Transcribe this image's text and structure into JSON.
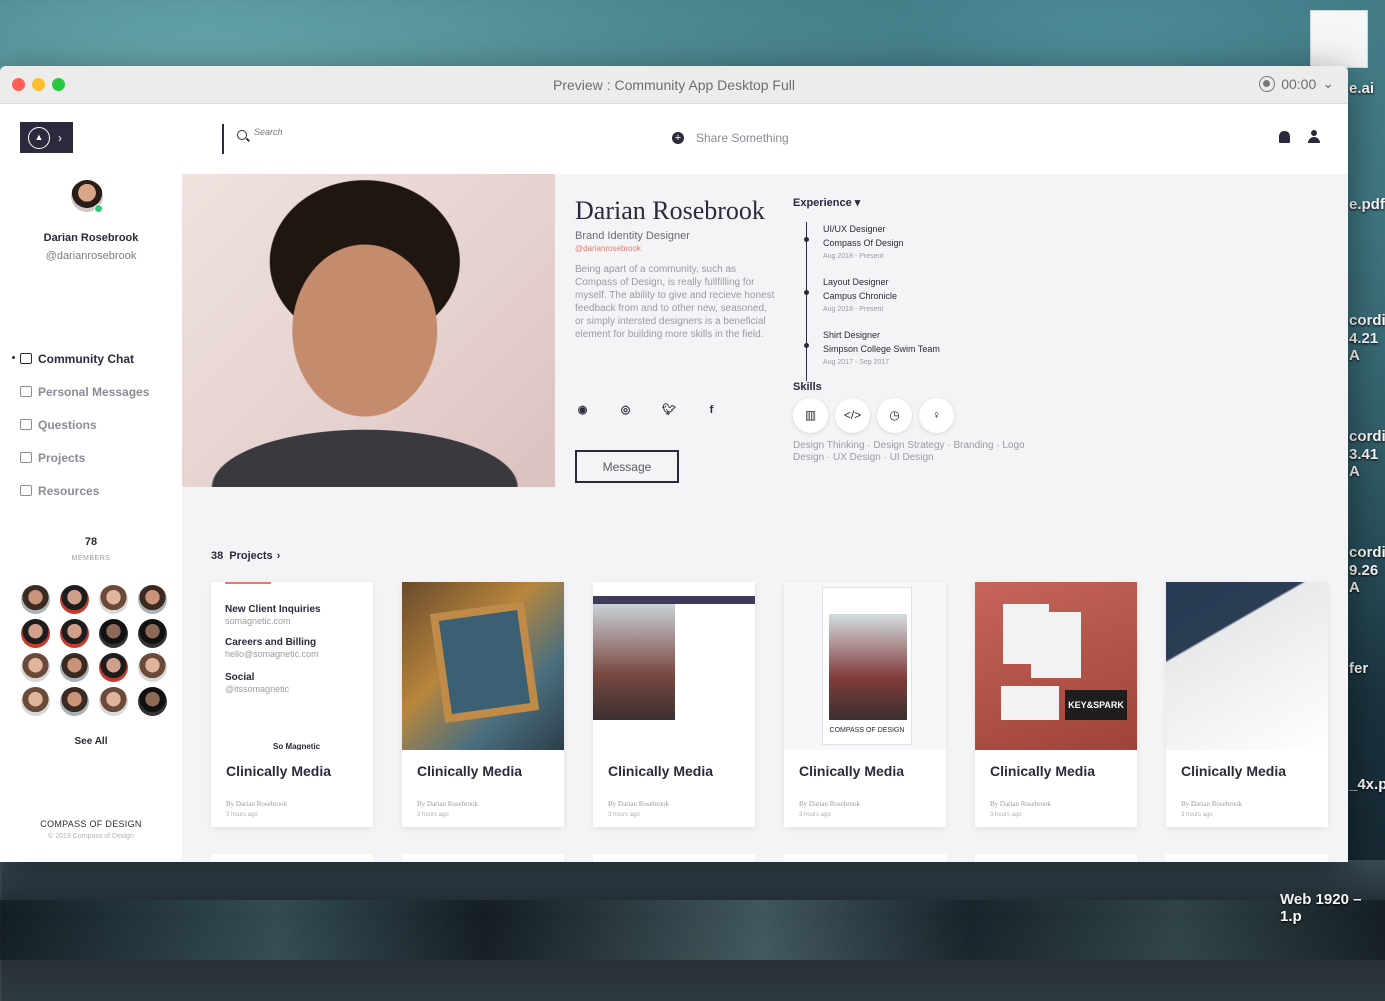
{
  "window": {
    "title": "Preview : Community App Desktop Full",
    "timer": "00:00"
  },
  "desktop": {
    "labels": [
      "e.ai",
      "e.pdf",
      "cordi",
      "4.21 A",
      "cordi",
      "3.41 A",
      "cordi",
      "9.26 A",
      "fer",
      "_4x.p",
      "Web 1920 – 1.p"
    ]
  },
  "sidebar": {
    "user_name": "Darian Rosebrook",
    "user_handle": "@darianrosebrook",
    "nav": [
      {
        "label": "Community Chat",
        "icon": "chat-icon",
        "active": true
      },
      {
        "label": "Personal Messages",
        "icon": "envelope-icon",
        "active": false
      },
      {
        "label": "Questions",
        "icon": "question-icon",
        "active": false
      },
      {
        "label": "Projects",
        "icon": "projects-icon",
        "active": false
      },
      {
        "label": "Resources",
        "icon": "book-icon",
        "active": false
      }
    ],
    "members_count": "78",
    "members_label": "MEMBERS",
    "see_all": "See All",
    "brand": "COMPASS OF DESIGN",
    "copyright": "© 2019 Compass of Design"
  },
  "header": {
    "search_placeholder": "Search",
    "share_label": "Share Something"
  },
  "profile": {
    "name": "Darian Rosebrook",
    "role": "Brand Identity Designer",
    "handle": "@darianrosebrook",
    "bio": "Being apart of a community, such as Compass of Design, is really fullfilling for myself. The ability to give and recieve honest feedback from and to other new, seasoned, or simply intersted designers is a beneficial element for building more skills in the field.",
    "message_button": "Message",
    "socials": [
      "globe-icon",
      "instagram-icon",
      "twitter-icon",
      "facebook-icon"
    ]
  },
  "experience": {
    "heading": "Experience",
    "items": [
      {
        "title": "UI/UX Designer",
        "company": "Compass Of Design",
        "dates": "Aug 2018 - Present"
      },
      {
        "title": "Layout Designer",
        "company": "Campus Chronicle",
        "dates": "Aug 2018 - Present"
      },
      {
        "title": "Shirt Designer",
        "company": "Simpson College Swim Team",
        "dates": "Aug 2017 - Sep 2017"
      }
    ]
  },
  "skills": {
    "heading": "Skills",
    "icons": [
      "chart-icon",
      "code-icon",
      "stopwatch-icon",
      "lightbulb-icon"
    ],
    "text": "Design Thinking · Design Strategy · Branding · Logo Design · UX Design · UI Design"
  },
  "projects": {
    "count": "38",
    "label": "Projects",
    "card1": {
      "lines": [
        {
          "title": "New Client Inquiries",
          "sub": "somagnetic.com"
        },
        {
          "title": "Careers and Billing",
          "sub": "hello@somagnetic.com"
        },
        {
          "title": "Social",
          "sub": "@itssomagnetic"
        }
      ],
      "footer": "So Magnetic"
    },
    "card4_caption": "COMPASS OF DESIGN",
    "card5_caption": "KEY&SPARK",
    "cards": [
      {
        "title": "Clinically Media",
        "by": "By Darian Rosebrook",
        "time": "3 hours ago"
      },
      {
        "title": "Clinically Media",
        "by": "By Darian Rosebrook",
        "time": "3 hours ago"
      },
      {
        "title": "Clinically Media",
        "by": "By Darian Rosebrook",
        "time": "3 hours ago"
      },
      {
        "title": "Clinically Media",
        "by": "By Darian Rosebrook",
        "time": "3 hours ago"
      },
      {
        "title": "Clinically Media",
        "by": "By Darian Rosebrook",
        "time": "3 hours ago"
      },
      {
        "title": "Clinically Media",
        "by": "By Darian Rosebrook",
        "time": "3 hours ago"
      }
    ]
  }
}
